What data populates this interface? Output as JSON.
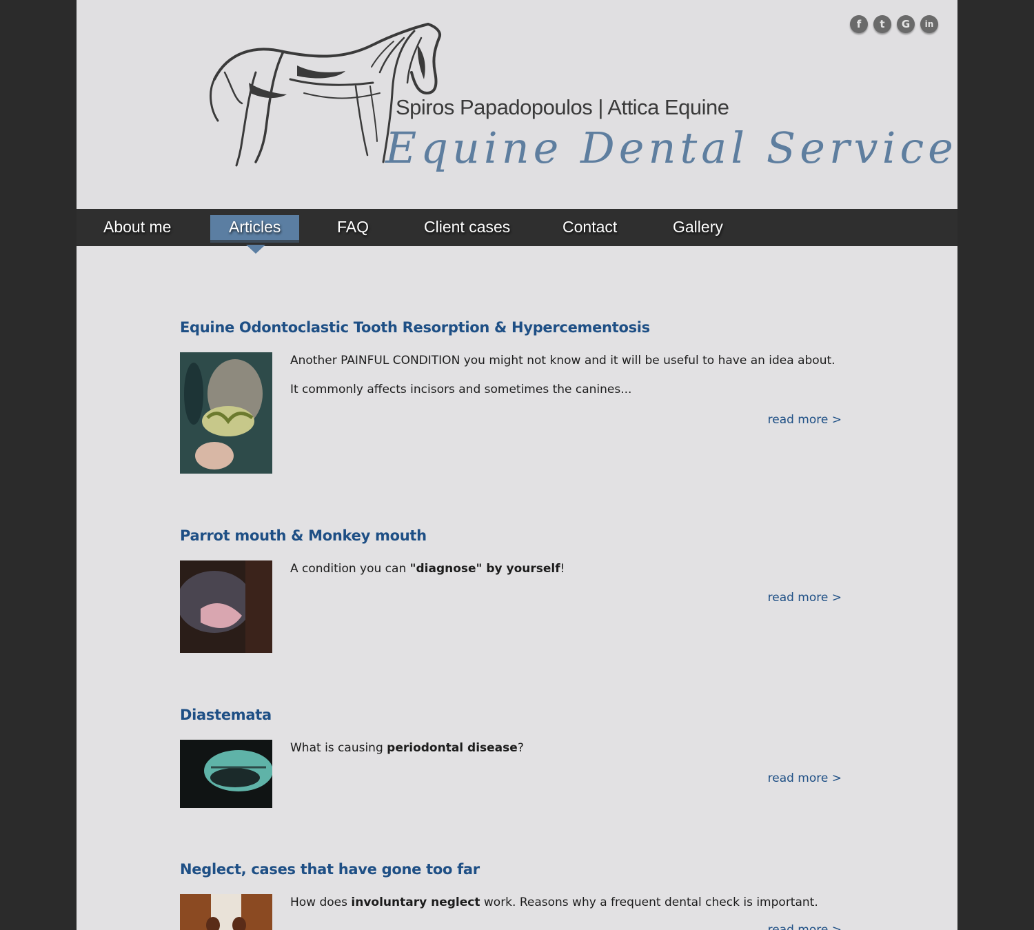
{
  "header": {
    "brand_line": "Spiros Papadopoulos | Attica Equine",
    "brand_script": "Equine Dental Services",
    "social": [
      {
        "name": "facebook-icon",
        "glyph": "f"
      },
      {
        "name": "twitter-icon",
        "glyph": "t"
      },
      {
        "name": "google-icon",
        "glyph": "G"
      },
      {
        "name": "linkedin-icon",
        "glyph": "in"
      }
    ]
  },
  "nav": {
    "items": [
      {
        "label": "About me"
      },
      {
        "label": "Articles",
        "active": true
      },
      {
        "label": "FAQ"
      },
      {
        "label": "Client cases"
      },
      {
        "label": "Contact"
      },
      {
        "label": "Gallery"
      }
    ]
  },
  "articles": [
    {
      "title": "Equine Odontoclastic Tooth Resorption & Hypercementosis",
      "lines": [
        "Another PAINFUL CONDITION you might not know and it will be useful to have an idea about.",
        "It commonly affects incisors and sometimes the canines..."
      ],
      "read_more": "read more >"
    },
    {
      "title": "Parrot mouth & Monkey mouth",
      "text_pre": "A condition you can ",
      "text_bold": "\"diagnose\" by yourself",
      "text_post": "!",
      "read_more": "read more >"
    },
    {
      "title": "Diastemata",
      "text_pre": "What is causing ",
      "text_bold": "periodontal disease",
      "text_post": "?",
      "read_more": "read more >"
    },
    {
      "title": "Neglect, cases that have gone too far",
      "text_pre": "How does ",
      "text_bold": "involuntary neglect",
      "text_post": " work. Reasons why a frequent dental check is important.",
      "read_more": "read more >"
    }
  ]
}
